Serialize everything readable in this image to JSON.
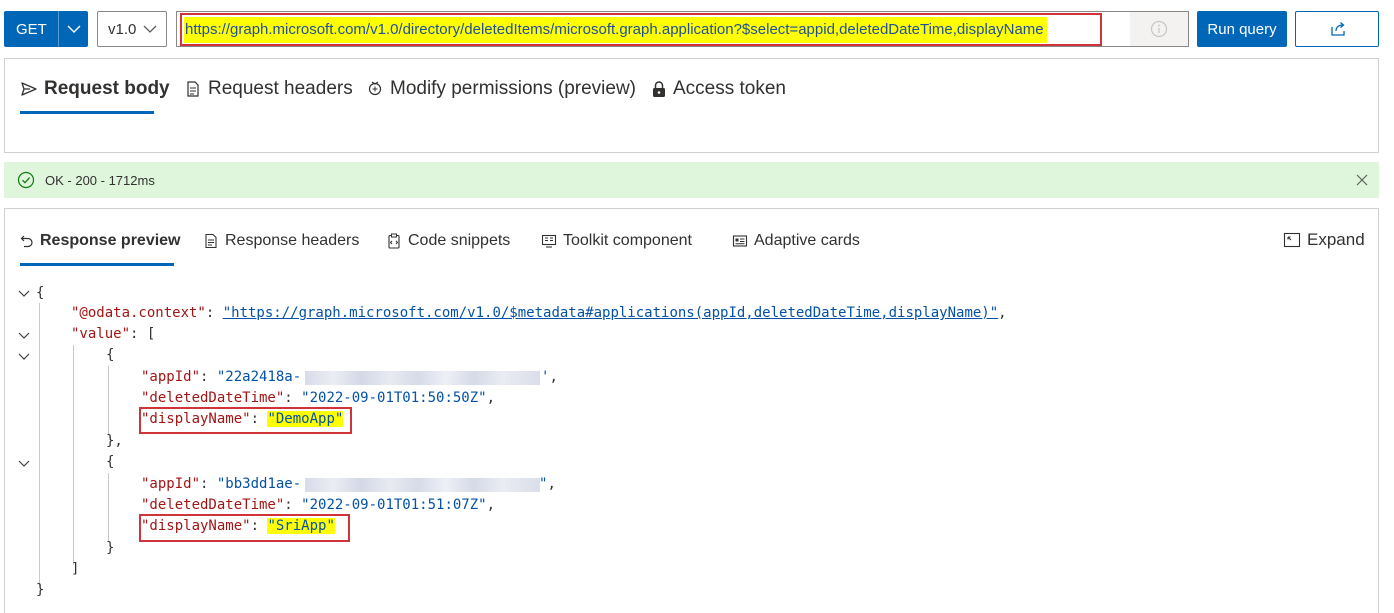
{
  "query_bar": {
    "method": "GET",
    "version": "v1.0",
    "url": "https://graph.microsoft.com/v1.0/directory/deletedItems/microsoft.graph.application?$select=appid,deletedDateTime,displayName",
    "run_label": "Run query",
    "info_icon": "info-icon",
    "share_icon": "share-icon"
  },
  "request_tabs": [
    {
      "label": "Request body",
      "icon": "send-icon",
      "active": true
    },
    {
      "label": "Request headers",
      "icon": "document-icon",
      "active": false
    },
    {
      "label": "Modify permissions (preview)",
      "icon": "badge-icon",
      "active": false
    },
    {
      "label": "Access token",
      "icon": "lock-icon",
      "active": false
    }
  ],
  "status": {
    "text": "OK - 200 - 1712ms",
    "color": "#dff6dd"
  },
  "response_tabs": [
    {
      "label": "Response preview",
      "icon": "undo-icon",
      "active": true
    },
    {
      "label": "Response headers",
      "icon": "document-icon",
      "active": false
    },
    {
      "label": "Code snippets",
      "icon": "clipboard-icon",
      "active": false
    },
    {
      "label": "Toolkit component",
      "icon": "toolkit-icon",
      "active": false
    },
    {
      "label": "Adaptive cards",
      "icon": "card-icon",
      "active": false
    }
  ],
  "expand_label": "Expand",
  "response": {
    "open_brace": "{",
    "context_key": "\"@odata.context\"",
    "context_value": "\"https://graph.microsoft.com/v1.0/$metadata#applications(appId,deletedDateTime,displayName)\"",
    "value_key": "\"value\"",
    "items": [
      {
        "appId_key": "\"appId\"",
        "appId_value": "\"22a2418a-",
        "appId_tail": "'",
        "deleted_key": "\"deletedDateTime\"",
        "deleted_value": "\"2022-09-01T01:50:50Z\"",
        "name_key": "\"displayName\"",
        "name_value": "\"DemoApp\""
      },
      {
        "appId_key": "\"appId\"",
        "appId_value": "\"bb3dd1ae-",
        "appId_tail": "\"",
        "deleted_key": "\"deletedDateTime\"",
        "deleted_value": "\"2022-09-01T01:51:07Z\"",
        "name_key": "\"displayName\"",
        "name_value": "\"SriApp\""
      }
    ]
  },
  "colors": {
    "accent": "#0067b8",
    "json_key": "#a31515",
    "json_string": "#0451a5",
    "highlight": "#ffff00",
    "annotation_box": "#d13438"
  }
}
